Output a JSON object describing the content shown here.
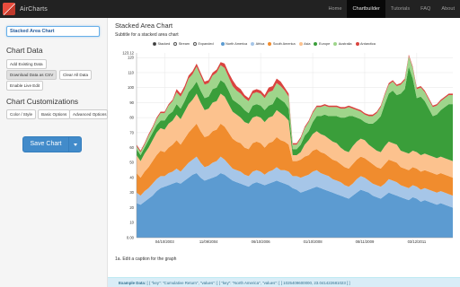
{
  "app": {
    "name": "AirCharts"
  },
  "nav": {
    "items": [
      "Home",
      "Chartbuilder",
      "Tutorials",
      "FAQ",
      "About"
    ],
    "active": "Chartbuilder"
  },
  "sidebar": {
    "title_value": "Stacked Area Chart",
    "chart_data_heading": "Chart Data",
    "buttons": {
      "add_existing": "Add Existing Data",
      "download_csv": "Download Data as CSV",
      "clear_all": "Clear All Data",
      "enable_live": "Enable Live Edit"
    },
    "customizations_heading": "Chart Customizations",
    "custom_buttons": {
      "color_style": "Color / Style",
      "basic_options": "Basic Options",
      "advanced_options": "Advanced Options"
    },
    "save_label": "Save Chart"
  },
  "main": {
    "title": "Stacked Area Chart",
    "subtitle": "Subtitle for a stacked area chart",
    "caption": "1a. Edit a caption for the graph",
    "example_label": "Example Data:",
    "example_text": " [ { \"key\": \"Cumulative Return\", \"values\": [ { \"key\": \"North America\", \"values\": [ [ 1025409600000, 23.041422681023 ] ]"
  },
  "controls": [
    {
      "label": "Stacked",
      "selected": true
    },
    {
      "label": "Stream",
      "selected": false
    },
    {
      "label": "Expanded",
      "selected": false
    }
  ],
  "colors": {
    "accent": "#428bca",
    "navbar": "#222222",
    "North America": "#5c9bd1",
    "Africa": "#a6c6e8",
    "South America": "#f08c2e",
    "Asia": "#fcc28e",
    "Europe": "#3a9e3a",
    "Australia": "#9fd58b",
    "Antarctica": "#d9443f"
  },
  "chart_data": {
    "type": "area",
    "stacked": true,
    "ylim": [
      0,
      123.12
    ],
    "ytick_labels": [
      "0.00",
      "10",
      "20",
      "30",
      "40",
      "50",
      "60",
      "70",
      "80",
      "90",
      "100",
      "110",
      "120",
      "123.12"
    ],
    "xtick_labels": [
      "04/10/2003",
      "11/09/2004",
      "06/10/2006",
      "01/10/2008",
      "08/11/2009",
      "03/12/2011"
    ],
    "xtick_positions": [
      7,
      18,
      31,
      44,
      57,
      70
    ],
    "grid": true,
    "legend_position": "top",
    "series": [
      {
        "name": "North America",
        "values": [
          23,
          22,
          24,
          26,
          28,
          31,
          33,
          34,
          35,
          36,
          37,
          36,
          38,
          40,
          42,
          43,
          40,
          38,
          39,
          40,
          41,
          43,
          42,
          40,
          38,
          37,
          36,
          35,
          34,
          36,
          37,
          36,
          35,
          36,
          37,
          38,
          37,
          36,
          35,
          33,
          32,
          30,
          31,
          32,
          33,
          34,
          33,
          32,
          31,
          30,
          29,
          28,
          27,
          26,
          28,
          30,
          32,
          31,
          30,
          28,
          27,
          26,
          28,
          30,
          29,
          28,
          27,
          26,
          25,
          27,
          26,
          24,
          25,
          24,
          23,
          22,
          23,
          22,
          21,
          20
        ]
      },
      {
        "name": "Africa",
        "values": [
          7,
          6,
          7,
          7,
          8,
          8,
          8,
          7,
          8,
          8,
          9,
          8,
          9,
          10,
          10,
          11,
          10,
          9,
          9,
          10,
          10,
          11,
          10,
          9,
          8,
          8,
          8,
          7,
          7,
          8,
          8,
          8,
          7,
          8,
          8,
          9,
          8,
          9,
          9,
          8,
          9,
          10,
          10,
          10,
          11,
          11,
          10,
          10,
          10,
          9,
          9,
          9,
          8,
          8,
          8,
          9,
          9,
          9,
          8,
          8,
          8,
          8,
          8,
          9,
          9,
          9,
          8,
          8,
          8,
          8,
          8,
          8,
          8,
          8,
          8,
          8,
          8,
          8,
          8,
          8
        ]
      },
      {
        "name": "South America",
        "values": [
          13,
          12,
          13,
          14,
          15,
          16,
          17,
          16,
          17,
          18,
          19,
          18,
          19,
          20,
          21,
          22,
          21,
          20,
          20,
          21,
          21,
          22,
          22,
          21,
          20,
          19,
          19,
          18,
          18,
          19,
          19,
          19,
          18,
          19,
          19,
          20,
          20,
          19,
          18,
          10,
          10,
          12,
          13,
          13,
          14,
          14,
          14,
          14,
          13,
          13,
          13,
          12,
          12,
          12,
          13,
          13,
          13,
          13,
          13,
          13,
          12,
          12,
          13,
          13,
          13,
          13,
          12,
          12,
          12,
          12,
          12,
          12,
          12,
          12,
          12,
          12,
          12,
          12,
          12,
          12
        ]
      },
      {
        "name": "Asia",
        "values": [
          12,
          11,
          12,
          13,
          14,
          15,
          15,
          15,
          16,
          16,
          17,
          17,
          18,
          19,
          19,
          20,
          19,
          18,
          18,
          19,
          19,
          20,
          20,
          19,
          18,
          18,
          17,
          17,
          17,
          17,
          17,
          17,
          17,
          17,
          17,
          18,
          18,
          17,
          16,
          4,
          4,
          5,
          8,
          10,
          11,
          12,
          12,
          12,
          12,
          12,
          12,
          11,
          11,
          11,
          12,
          12,
          12,
          12,
          11,
          11,
          11,
          11,
          12,
          12,
          12,
          12,
          11,
          11,
          11,
          11,
          11,
          11,
          11,
          11,
          11,
          11,
          11,
          11,
          11,
          11
        ]
      },
      {
        "name": "Europe",
        "values": [
          4,
          4,
          4,
          5,
          5,
          5,
          5,
          6,
          6,
          6,
          7,
          7,
          7,
          8,
          8,
          8,
          8,
          8,
          8,
          9,
          9,
          9,
          9,
          9,
          8,
          8,
          8,
          8,
          7,
          8,
          8,
          8,
          8,
          8,
          8,
          9,
          9,
          9,
          8,
          4,
          4,
          5,
          6,
          6,
          8,
          10,
          12,
          14,
          15,
          17,
          18,
          20,
          22,
          24,
          20,
          16,
          13,
          12,
          14,
          16,
          20,
          24,
          28,
          32,
          35,
          33,
          38,
          42,
          58,
          48,
          36,
          39,
          35,
          31,
          27,
          29,
          31,
          34,
          37,
          38
        ]
      },
      {
        "name": "Australia",
        "values": [
          2,
          2,
          2,
          3,
          3,
          4,
          5,
          5,
          6,
          7,
          8,
          8,
          8,
          9,
          9,
          10,
          10,
          9,
          9,
          9,
          10,
          10,
          10,
          9,
          9,
          8,
          8,
          8,
          8,
          8,
          8,
          8,
          8,
          9,
          9,
          9,
          9,
          8,
          8,
          3,
          3,
          4,
          5,
          6,
          6,
          6,
          6,
          6,
          6,
          6,
          6,
          6,
          6,
          6,
          5,
          5,
          5,
          5,
          5,
          5,
          5,
          6,
          6,
          6,
          6,
          6,
          6,
          6,
          7,
          7,
          6,
          6,
          6,
          6,
          6,
          6,
          6,
          6,
          6,
          6
        ]
      },
      {
        "name": "Antarctica",
        "values": [
          1,
          1,
          1,
          1,
          1,
          1,
          1,
          1,
          1,
          1,
          2,
          2,
          2,
          2,
          2,
          2,
          2,
          2,
          2,
          2,
          2,
          2,
          3,
          3,
          4,
          3,
          3,
          2,
          2,
          2,
          2,
          2,
          2,
          3,
          3,
          3,
          3,
          2,
          2,
          1,
          1,
          1,
          1,
          1,
          1,
          1,
          1,
          1,
          1,
          1,
          1,
          1,
          1,
          1,
          1,
          1,
          1,
          1,
          1,
          1,
          1,
          1,
          1,
          1,
          1,
          1,
          1,
          1,
          1,
          1,
          1,
          1,
          1,
          1,
          1,
          1,
          1,
          1,
          1,
          1
        ]
      }
    ]
  }
}
